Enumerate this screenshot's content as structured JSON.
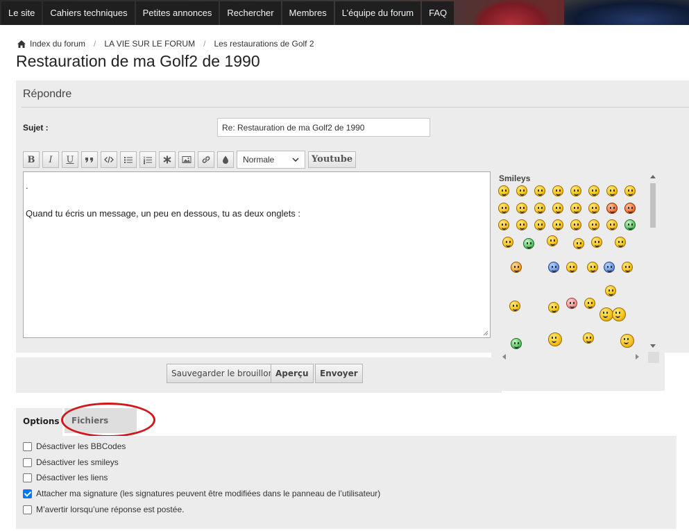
{
  "nav": {
    "items": [
      "Le site",
      "Cahiers techniques",
      "Petites annonces",
      "Rechercher",
      "Membres",
      "L’équipe du forum",
      "FAQ"
    ]
  },
  "breadcrumb": {
    "home_icon": "home-icon",
    "items": [
      "Index du forum",
      "LA VIE SUR LE FORUM",
      "Les restaurations de Golf 2"
    ],
    "separator": "/"
  },
  "page_title": "Restauration de ma Golf2 de 1990",
  "reply": {
    "heading": "Répondre",
    "subject_label": "Sujet :",
    "subject_value": "Re: Restauration de ma Golf2 de 1990",
    "toolbar": {
      "bold": "B",
      "italic": "I",
      "underline": "U",
      "font_size_selected": "Normale",
      "youtube": "Youtube",
      "icons": [
        "quote-icon",
        "code-icon",
        "list-icon",
        "ordered-list-icon",
        "asterisk-icon",
        "image-icon",
        "link-icon",
        "color-drop-icon"
      ]
    },
    "message_lines": [
      ".",
      "",
      "Quand tu écris un message, un peu en dessous, tu as deux onglets :"
    ]
  },
  "smileys": {
    "title": "Smileys"
  },
  "actions": {
    "save_draft": "Sauvegarder le brouillon",
    "preview": "Aperçu",
    "submit": "Envoyer"
  },
  "tabs": {
    "options": "Options",
    "attachments": "Fichiers joints"
  },
  "options": [
    {
      "label": "Désactiver les BBCodes",
      "checked": false
    },
    {
      "label": "Désactiver les smileys",
      "checked": false
    },
    {
      "label": "Désactiver les liens",
      "checked": false
    },
    {
      "label": "Attacher ma signature (les signatures peuvent être modifiées dans le panneau de l’utilisateur)",
      "checked": true
    },
    {
      "label": "M’avertir lorsqu’une réponse est postée.",
      "checked": false
    }
  ],
  "colors": {
    "nav_bg": "#1f1f1f",
    "panel_bg": "#ececec",
    "annotation": "#d3161a",
    "checkbox_checked": "#0075ff"
  }
}
